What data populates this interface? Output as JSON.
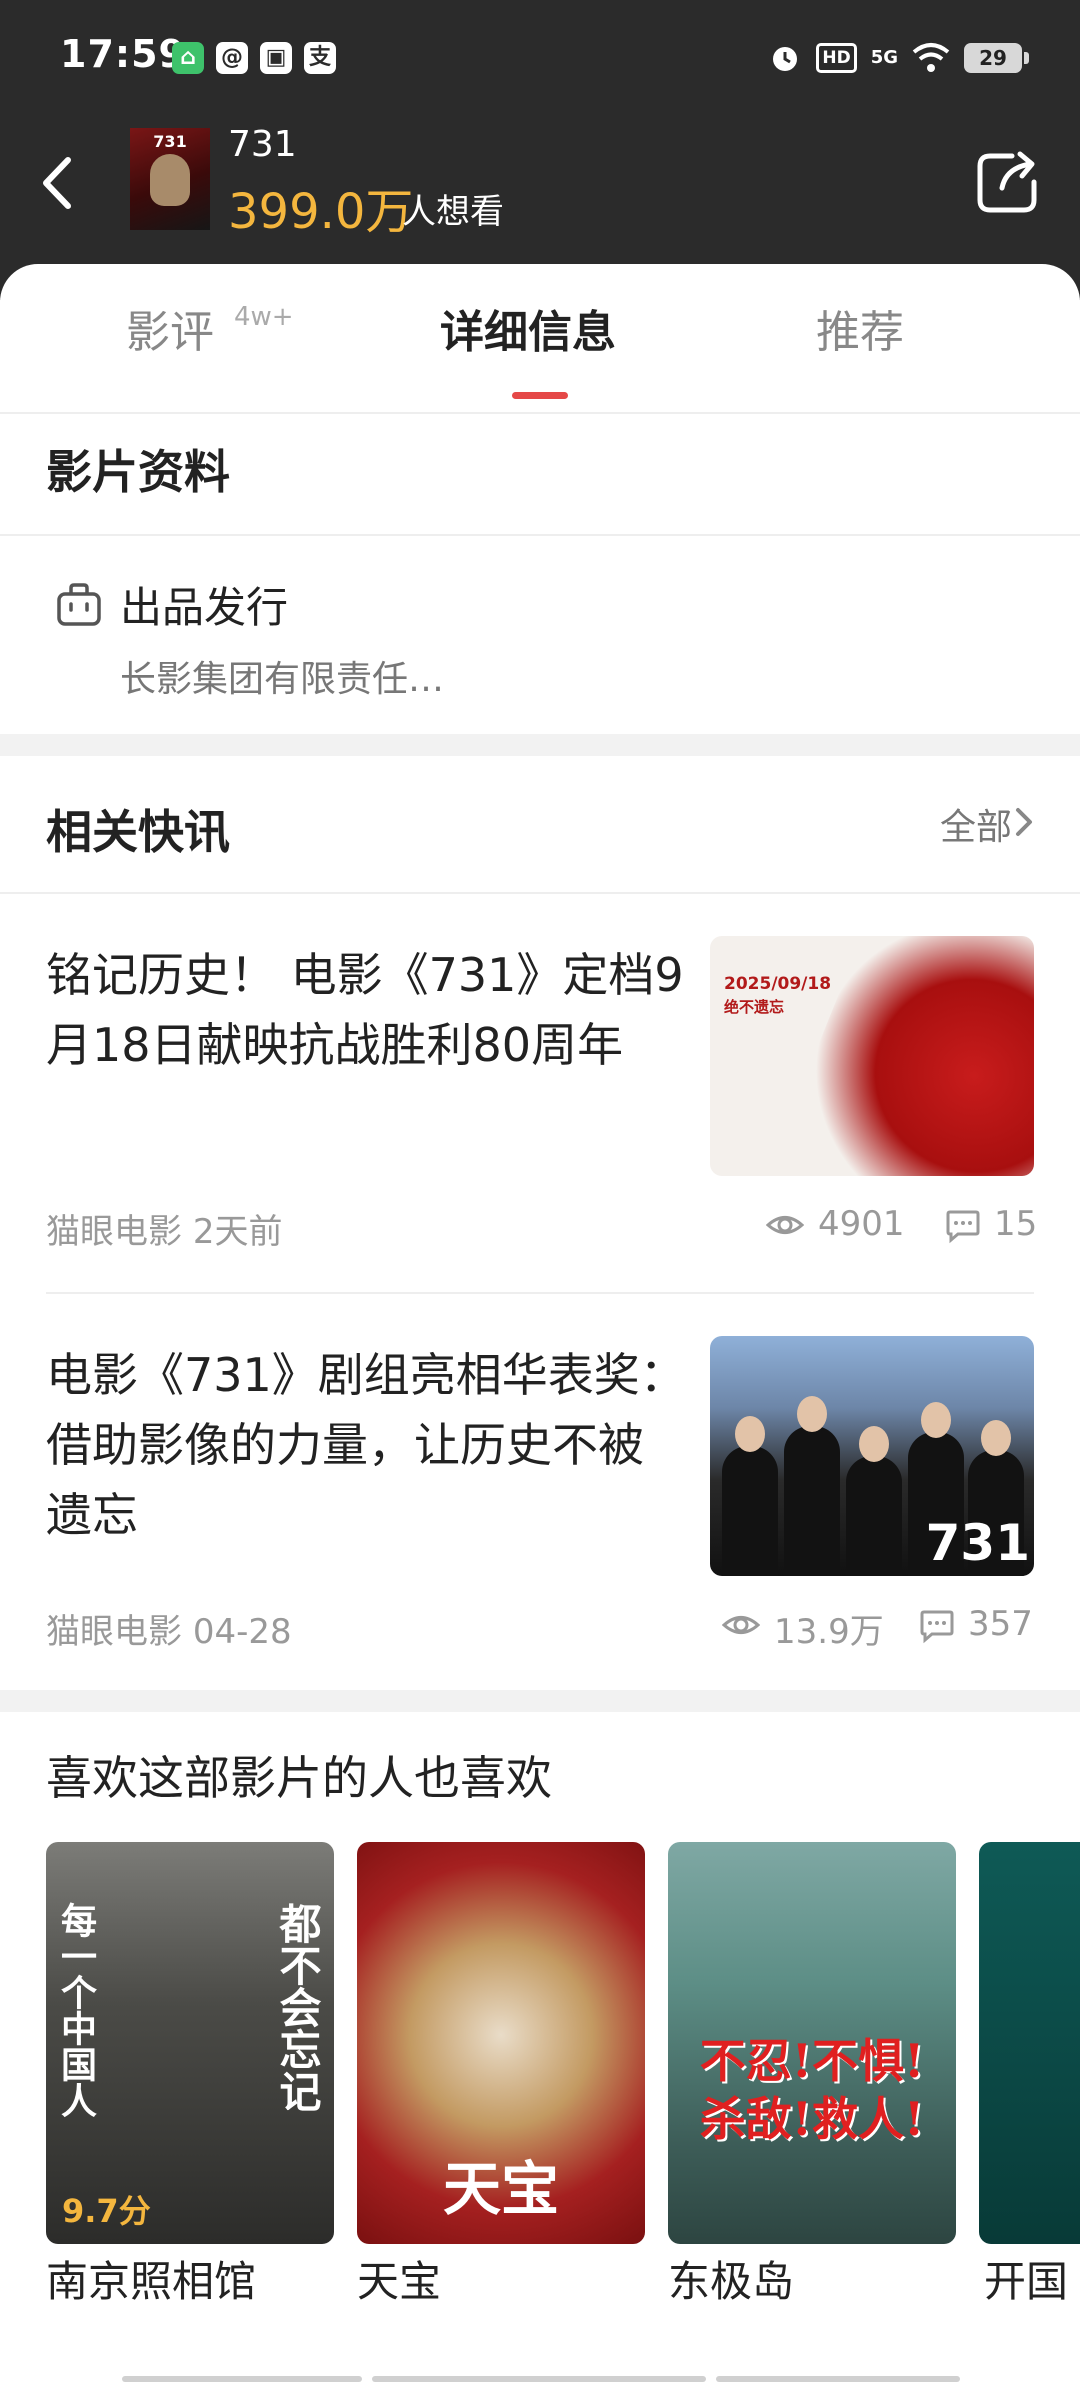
{
  "status_bar": {
    "time": "17:59",
    "notification_icons": [
      "支"
    ],
    "network_label": "5G",
    "hd_label": "HD",
    "battery_level": "29"
  },
  "header": {
    "movie_title": "731",
    "poster_label": "731",
    "want_count": "399.0万",
    "want_suffix": "人想看"
  },
  "tabs": [
    {
      "label": "影评",
      "badge": "4w+"
    },
    {
      "label": "详细信息"
    },
    {
      "label": "推荐"
    }
  ],
  "film_info": {
    "section_title": "影片资料",
    "production_label": "出品发行",
    "production_value": "长影集团有限责任…"
  },
  "news": {
    "section_title": "相关快讯",
    "view_all_label": "全部",
    "items": [
      {
        "title": "铭记历史！ 电影《731》定档9月18日献映抗战胜利80周年",
        "source": "猫眼电影",
        "time": "2天前",
        "views": "4901",
        "comments": "15",
        "image_text_date": "2025/09/18",
        "image_text_caption": "绝不遗忘"
      },
      {
        "title": "电影《731》剧组亮相华表奖：借助影像的力量，让历史不被遗忘",
        "source": "猫眼电影",
        "time": "04-28",
        "views": "13.9万",
        "comments": "357",
        "image_text_tag": "731"
      }
    ]
  },
  "recommendations": {
    "section_title": "喜欢这部影片的人也喜欢",
    "items": [
      {
        "name": "南京照相馆",
        "score": "9.7分",
        "poster_text_left": "每一个中国人",
        "poster_text_right": "都不会忘记"
      },
      {
        "name": "天宝",
        "poster_text": "天宝"
      },
      {
        "name": "东极岛",
        "poster_text": "不忍!不惧! 杀敌!救人!"
      },
      {
        "name": "开国"
      }
    ]
  },
  "colors": {
    "header_bg": "#2b2b2b",
    "accent_red": "#e54847",
    "want_count_gold": "#f4b63e"
  }
}
